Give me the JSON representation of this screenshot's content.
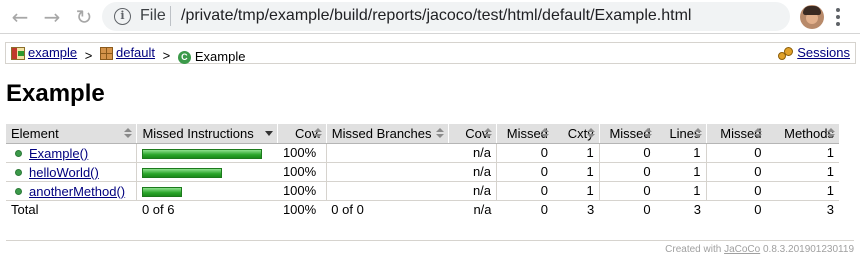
{
  "browser": {
    "back_glyph": "←",
    "forward_glyph": "→",
    "reload_glyph": "↻",
    "info_glyph": "i",
    "scheme_label": "File",
    "url": "/private/tmp/example/build/reports/jacoco/test/html/default/Example.html",
    "star_glyph": "☆",
    "icons": [
      "back-arrow-icon",
      "forward-arrow-icon",
      "reload-icon",
      "info-icon",
      "star-icon",
      "avatar",
      "menu-icon"
    ]
  },
  "breadcrumb": {
    "items": [
      {
        "label": "example",
        "icon": "report-icon"
      },
      {
        "label": "default",
        "icon": "package-icon"
      },
      {
        "label": "Example",
        "icon": "class-icon"
      }
    ],
    "separator": ">",
    "class_glyph": "C",
    "sessions_label": "Sessions"
  },
  "title": "Example",
  "table": {
    "headers": [
      "Element",
      "Missed Instructions",
      "Cov.",
      "Missed Branches",
      "Cov.",
      "Missed",
      "Cxty",
      "Missed",
      "Lines",
      "Missed",
      "Methods"
    ],
    "rows": [
      {
        "name": "Example()",
        "coverage_bar": 1.0,
        "instr_cov": "100%",
        "branches": "",
        "branch_cov": "n/a",
        "missed_cxty": "0",
        "cxty": "1",
        "missed_lines": "0",
        "lines": "1",
        "missed_methods": "0",
        "methods": "1"
      },
      {
        "name": "helloWorld()",
        "coverage_bar": 1.0,
        "instr_cov": "100%",
        "branches": "",
        "branch_cov": "n/a",
        "missed_cxty": "0",
        "cxty": "1",
        "missed_lines": "0",
        "lines": "1",
        "missed_methods": "0",
        "methods": "1"
      },
      {
        "name": "anotherMethod()",
        "coverage_bar": 1.0,
        "instr_cov": "100%",
        "branches": "",
        "branch_cov": "n/a",
        "missed_cxty": "0",
        "cxty": "1",
        "missed_lines": "0",
        "lines": "1",
        "missed_methods": "0",
        "methods": "1"
      }
    ],
    "total": {
      "label": "Total",
      "instructions": "0 of 6",
      "instr_cov": "100%",
      "branches": "0 of 0",
      "branch_cov": "n/a",
      "missed_cxty": "0",
      "cxty": "3",
      "missed_lines": "0",
      "lines": "3",
      "missed_methods": "0",
      "methods": "3"
    }
  },
  "footer": {
    "prefix": "Created with",
    "link": "JaCoCo",
    "version": "0.8.3.201901230119"
  },
  "colors": {
    "link": "#00007f",
    "bar_green": "#2aa52a",
    "header_bg": "#e0e0e0"
  }
}
